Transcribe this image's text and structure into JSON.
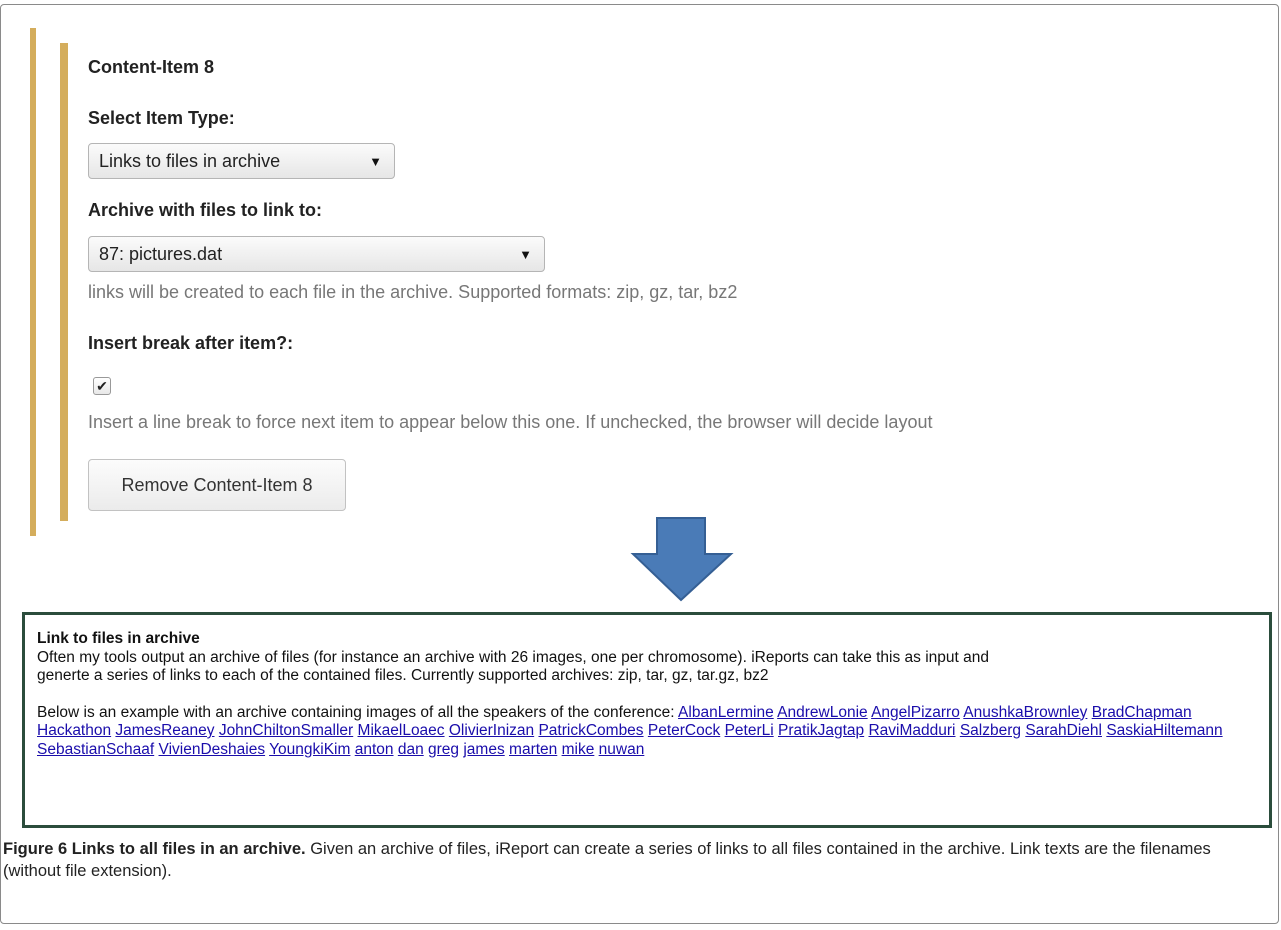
{
  "form": {
    "section_title": "Content-Item 8",
    "item_type_label": "Select Item Type:",
    "item_type_value": "Links to files in archive",
    "archive_label": "Archive with files to link to:",
    "archive_value": "87: pictures.dat",
    "archive_help": "links will be created to each file in the archive. Supported formats: zip, gz, tar, bz2",
    "break_label": "Insert break after item?:",
    "break_checked": true,
    "break_help": "Insert a line break to force next item to appear below this one. If unchecked, the browser will decide layout",
    "remove_button": "Remove Content-Item 8"
  },
  "colors": {
    "accent_bar": "#d4ad5c",
    "arrow": "#4a7bb7",
    "report_border": "#2b4d3c",
    "link": "#1a0dab"
  },
  "icons": {
    "dropdown": "caret-down-icon",
    "checkbox": "checkmark-icon",
    "arrow": "arrow-down-icon"
  },
  "report": {
    "title": "Link to files in archive",
    "description_line1": "Often my tools output an archive of files (for instance an archive with 26 images, one per chromosome). iReports can take this as input and",
    "description_line2": "generte a series of links to each of the contained files. Currently supported archives: zip, tar, gz, tar.gz, bz2",
    "example_intro": "Below is an example with an archive containing images of all the speakers of the conference:",
    "links": [
      "AlbanLermine",
      "AndrewLonie",
      "AngelPizarro",
      "AnushkaBrownley",
      "BradChapman",
      "Hackathon",
      "JamesReaney",
      "JohnChiltonSmaller",
      "MikaelLoaec",
      "OlivierInizan",
      "PatrickCombes",
      "PeterCock",
      "PeterLi",
      "PratikJagtap",
      "RaviMadduri",
      "Salzberg",
      "SarahDiehl",
      "SaskiaHiltemann",
      "SebastianSchaaf",
      "VivienDeshaies",
      "YoungkiKim",
      "anton",
      "dan",
      "greg",
      "james",
      "marten",
      "mike",
      "nuwan"
    ]
  },
  "caption": {
    "figure_label": "Figure 6 Links to all files in an archive.",
    "text": "Given an archive of files, iReport can create a series of links to all files contained in the archive. Link texts are the filenames (without file extension)."
  }
}
